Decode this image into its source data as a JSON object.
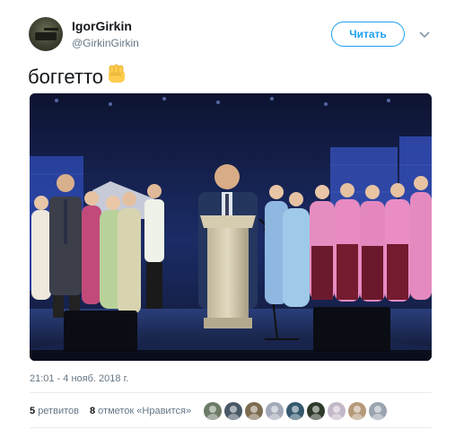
{
  "tweet": {
    "display_name": "IgorGirkin",
    "handle": "@GirkinGirkin",
    "follow_label": "Читать",
    "text": "боггетто",
    "emoji": "raised-fist-emoji",
    "timestamp": "21:01 - 4 нояб. 2018 г.",
    "photo_icon": "stage-photo"
  },
  "stats": {
    "retweets_count": "5",
    "retweets_label": "ретвитов",
    "likes_count": "8",
    "likes_label": "отметок «Нравится»"
  },
  "likers": [
    {
      "icon": "user-avatar-icon",
      "color": "#6c7a66"
    },
    {
      "icon": "user-avatar-icon",
      "color": "#4a5866"
    },
    {
      "icon": "user-avatar-icon",
      "color": "#7d6b4f"
    },
    {
      "icon": "user-avatar-icon",
      "color": "#a3a9b8"
    },
    {
      "icon": "user-avatar-icon",
      "color": "#35586e"
    },
    {
      "icon": "user-avatar-icon",
      "color": "#2f3a2b"
    },
    {
      "icon": "user-avatar-icon",
      "color": "#c3b8c8"
    },
    {
      "icon": "user-avatar-icon",
      "color": "#b59a7a"
    },
    {
      "icon": "user-avatar-icon",
      "color": "#9aa4b0"
    }
  ],
  "colors": {
    "accent": "#1da1f2",
    "text": "#14171a",
    "secondary": "#657786"
  }
}
